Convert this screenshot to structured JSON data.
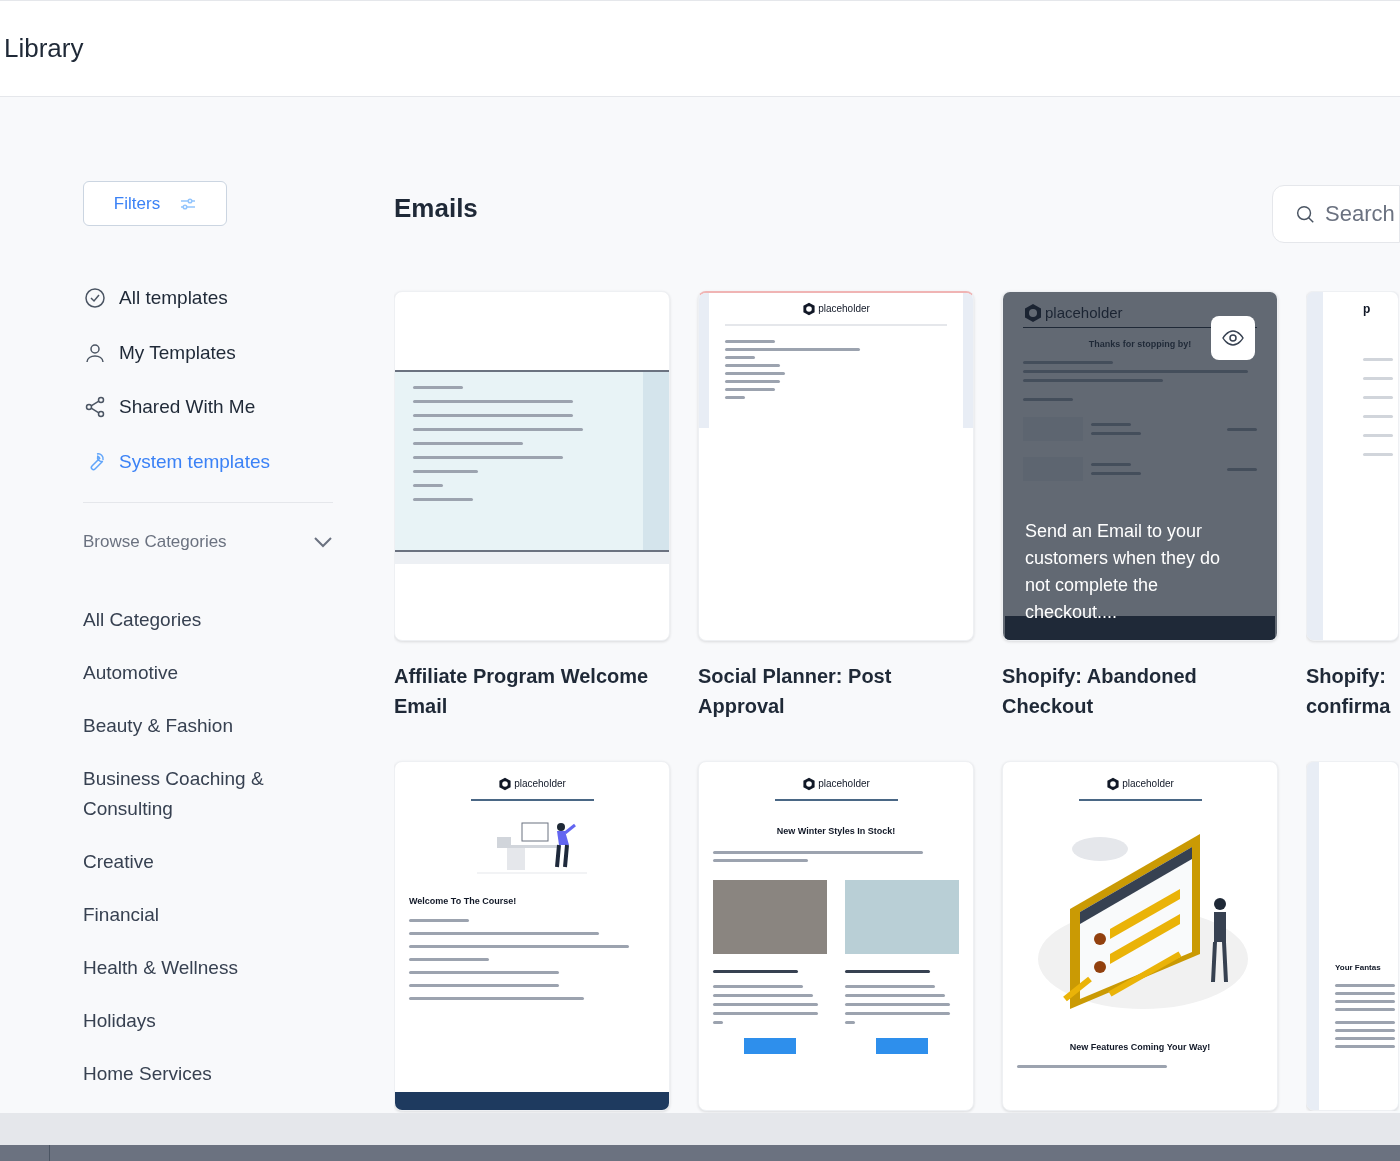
{
  "header": {
    "title": "Library"
  },
  "sidebar": {
    "filters_button": "Filters",
    "nav": [
      {
        "label": "All templates",
        "selected": false
      },
      {
        "label": "My Templates",
        "selected": false
      },
      {
        "label": "Shared With Me",
        "selected": false
      },
      {
        "label": "System templates",
        "selected": true
      }
    ],
    "browse": {
      "label": "Browse Categories",
      "expanded": true
    },
    "categories": [
      "All Categories",
      "Automotive",
      "Beauty & Fashion",
      "Business Coaching & Consulting",
      "Creative",
      "Financial",
      "Health & Wellness",
      "Holidays",
      "Home Services"
    ]
  },
  "content": {
    "title": "Emails",
    "search": {
      "placeholder": "Search"
    },
    "cards": [
      {
        "title": "Affiliate Program Welcome Email",
        "preview": {
          "kind": "banded"
        }
      },
      {
        "title": "Social Planner: Post Approval",
        "preview": {
          "kind": "short",
          "logo": "placeholder"
        }
      },
      {
        "title": "Shopify: Abandoned Checkout",
        "overlay": "Send an Email to your customers when they do not complete the checkout....",
        "preview": {
          "kind": "cart",
          "logo": "placeholder",
          "heading": "Thanks for stopping by!"
        }
      },
      {
        "title": "Shopify: confirma",
        "preview": {
          "kind": "partial",
          "logo": "p"
        }
      },
      {
        "preview": {
          "kind": "course",
          "logo": "placeholder",
          "heading": "Welcome To The Course!"
        }
      },
      {
        "preview": {
          "kind": "products",
          "logo": "placeholder",
          "heading": "New Winter Styles In Stock!"
        }
      },
      {
        "preview": {
          "kind": "features",
          "logo": "placeholder",
          "heading": "New Features Coming Your Way!"
        }
      },
      {
        "preview": {
          "kind": "fantasy",
          "heading": "Your Fantas"
        }
      }
    ]
  }
}
